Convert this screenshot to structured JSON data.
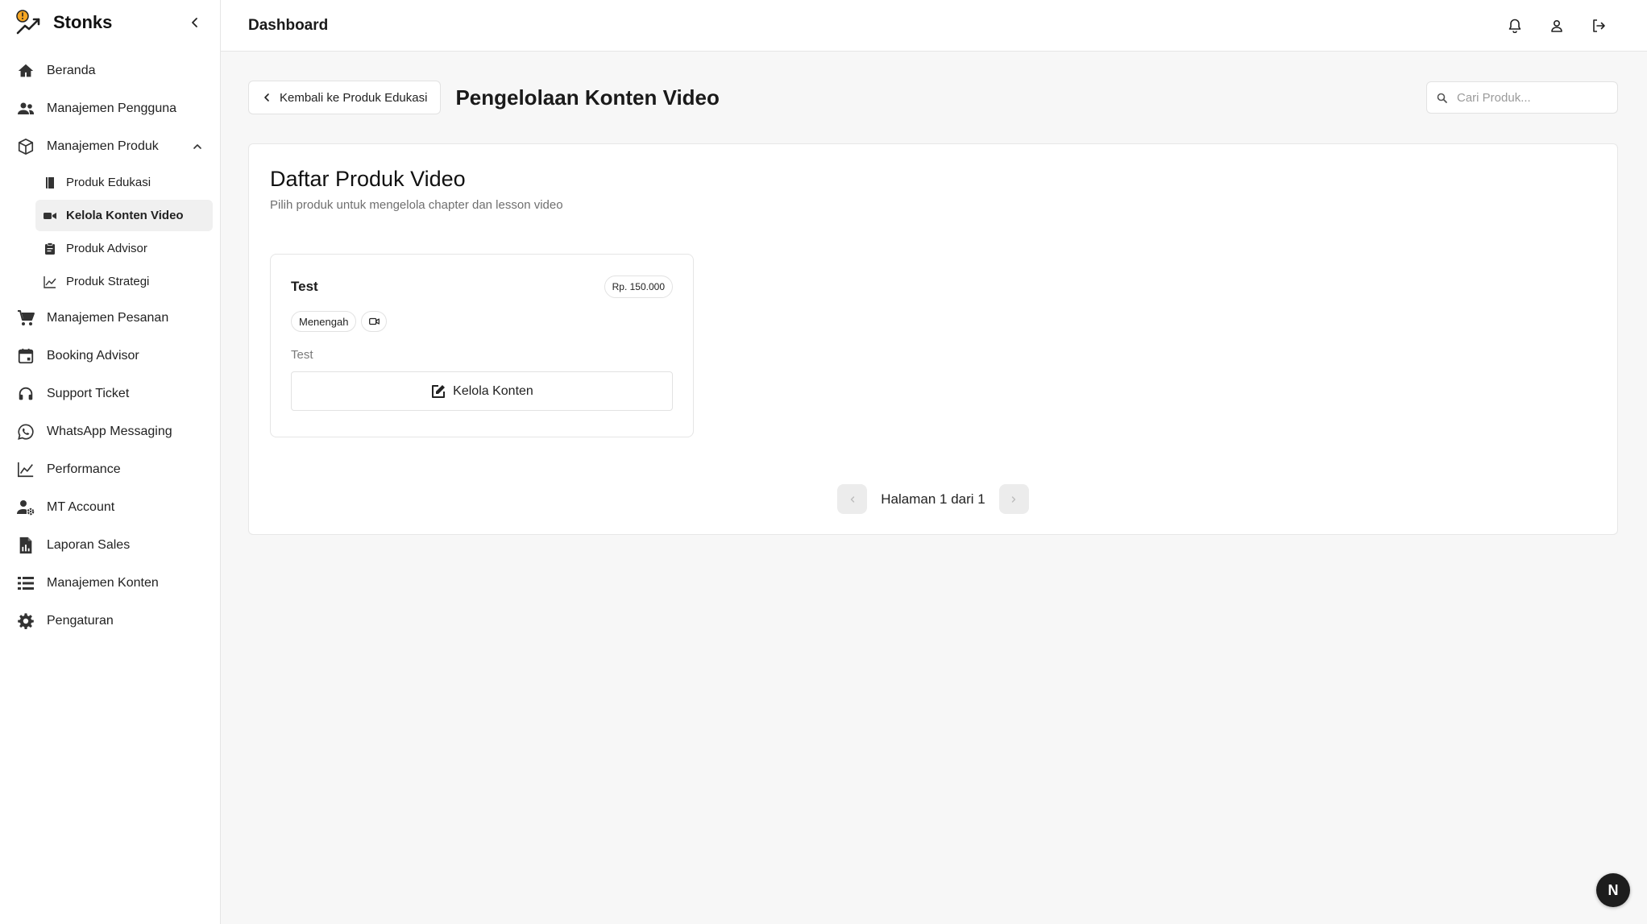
{
  "brand": {
    "name": "Stonks"
  },
  "header": {
    "title": "Dashboard"
  },
  "sidebar": {
    "items": [
      {
        "label": "Beranda",
        "icon": "home-icon"
      },
      {
        "label": "Manajemen Pengguna",
        "icon": "users-icon"
      },
      {
        "label": "Manajemen Produk",
        "icon": "box-icon",
        "expanded": true,
        "children": [
          {
            "label": "Produk Edukasi",
            "icon": "book-icon"
          },
          {
            "label": "Kelola Konten Video",
            "icon": "video-icon",
            "active": true
          },
          {
            "label": "Produk Advisor",
            "icon": "clipboard-icon"
          },
          {
            "label": "Produk Strategi",
            "icon": "chart-line-icon"
          }
        ]
      },
      {
        "label": "Manajemen Pesanan",
        "icon": "cart-icon"
      },
      {
        "label": "Booking Advisor",
        "icon": "calendar-icon"
      },
      {
        "label": "Support Ticket",
        "icon": "headset-icon"
      },
      {
        "label": "WhatsApp Messaging",
        "icon": "whatsapp-icon"
      },
      {
        "label": "Performance",
        "icon": "chart-line-icon"
      },
      {
        "label": "MT Account",
        "icon": "user-cog-icon"
      },
      {
        "label": "Laporan Sales",
        "icon": "report-icon"
      },
      {
        "label": "Manajemen Konten",
        "icon": "list-icon"
      },
      {
        "label": "Pengaturan",
        "icon": "gear-icon"
      }
    ]
  },
  "main": {
    "back_label": "Kembali ke Produk Edukasi",
    "title": "Pengelolaan Konten Video",
    "search": {
      "placeholder": "Cari Produk...",
      "value": ""
    },
    "panel": {
      "title": "Daftar Produk Video",
      "subtitle": "Pilih produk untuk mengelola chapter dan lesson video"
    },
    "card": {
      "name": "Test",
      "price": "Rp. 150.000",
      "level": "Menengah",
      "description": "Test",
      "button_label": "Kelola Konten"
    },
    "pagination": {
      "text": "Halaman 1 dari 1"
    }
  },
  "fab": {
    "label": "N"
  },
  "colors": {
    "accent": "#1a1a1a",
    "logo": "#f5a623"
  }
}
